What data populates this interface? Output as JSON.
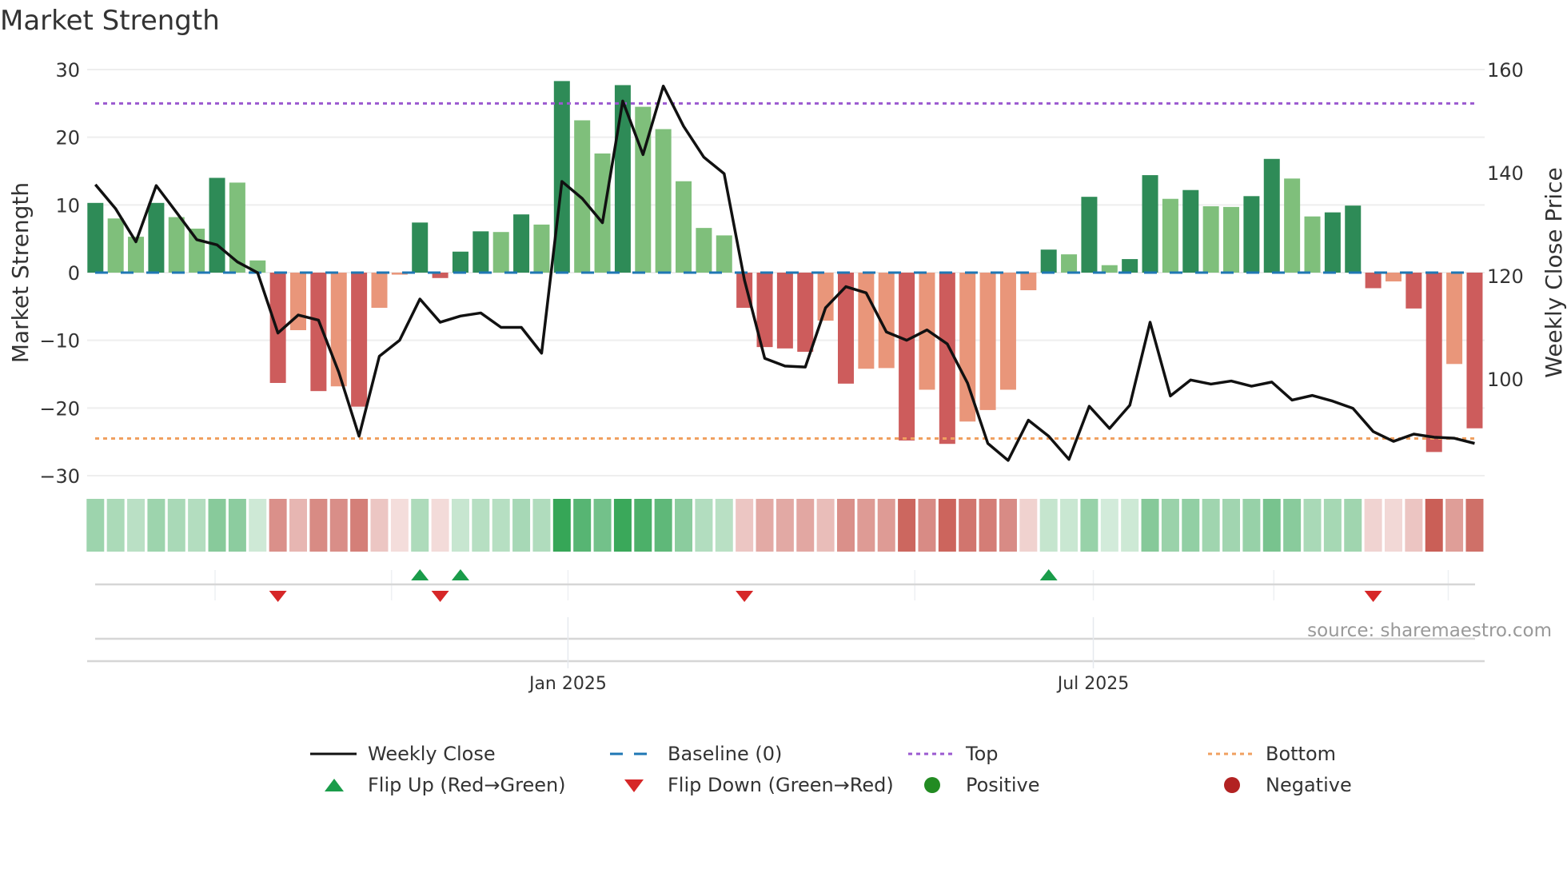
{
  "title": "Market Strength",
  "source": "source: sharemaestro.com",
  "chart_data": {
    "type": "bar",
    "title": "Market Strength",
    "ylabel": "Market Strength",
    "y2label": "Weekly Close Price",
    "ylim": [
      -30,
      30
    ],
    "y2lim": [
      80,
      160
    ],
    "left_ticks": [
      "30",
      "20",
      "10",
      "0",
      "−10",
      "−20",
      "−30"
    ],
    "left_tick_values": [
      30,
      20,
      10,
      0,
      -10,
      -20,
      -30
    ],
    "right_ticks": [
      "160",
      "140",
      "120",
      "100"
    ],
    "right_tick_values": [
      160,
      140,
      120,
      100
    ],
    "x_ticks": [
      {
        "label": "Jan 2025",
        "week_index": 23.3
      },
      {
        "label": "Jul 2025",
        "week_index": 49.2
      }
    ],
    "top_level": 25,
    "bottom_level": -24.5,
    "baseline": 0,
    "strength": [
      10.3,
      8,
      5.3,
      10.3,
      8.2,
      6.5,
      14,
      13.3,
      1.8,
      -16.3,
      -8.5,
      -17.5,
      -16.8,
      -19.8,
      -5.2,
      -0.3,
      7.4,
      -0.8,
      3.1,
      6.1,
      6.0,
      8.6,
      7.1,
      28.3,
      22.5,
      17.6,
      27.7,
      24.5,
      21.2,
      13.5,
      6.6,
      5.5,
      -5.2,
      -11,
      -11.2,
      -11.7,
      -7.1,
      -16.4,
      -14.2,
      -14.1,
      -24.8,
      -17.3,
      -25.3,
      -22,
      -20.3,
      -17.3,
      -2.6,
      3.4,
      2.7,
      11.2,
      1.1,
      2,
      14.4,
      10.9,
      12.2,
      9.8,
      9.7,
      11.3,
      16.8,
      13.9,
      8.3,
      8.9,
      9.9,
      -2.3,
      -1.3,
      -5.3,
      -26.5,
      -13.5,
      -23
    ],
    "weekly_close": [
      137.7,
      133,
      126.6,
      137.5,
      132.3,
      127,
      126,
      122.7,
      120.6,
      108.9,
      112.4,
      111.4,
      101.3,
      88.9,
      104.4,
      107.5,
      115.5,
      111,
      112.2,
      112.8,
      110,
      110,
      105,
      138.3,
      135,
      130.3,
      153.9,
      143.5,
      156.8,
      149,
      143,
      139.8,
      119.2,
      104,
      102.5,
      102.3,
      113.8,
      117.9,
      116.7,
      109.1,
      107.5,
      109.5,
      106.8,
      99.2,
      87.5,
      84.2,
      92,
      88.9,
      84.4,
      94.7,
      90.4,
      94.9,
      111,
      96.7,
      99.8,
      99,
      99.6,
      98.6,
      99.4,
      95.9,
      96.8,
      95.7,
      94.3,
      89.8,
      87.9,
      89.3,
      88.7,
      88.5,
      87.5
    ],
    "flip_up_weeks": [
      16,
      18,
      47
    ],
    "flip_down_weeks": [
      9,
      17,
      32,
      63
    ],
    "month_grid_weeks": [
      5.9,
      14.6,
      23.3,
      40.4,
      49.2,
      58.1,
      66.7
    ],
    "colors": {
      "pos_rising": "#2e8b57",
      "pos_falling": "#7fbf7b",
      "neg_falling": "#cd5c5c",
      "neg_rising": "#e9967a",
      "line": "#111111",
      "baseline": "#1f77b4",
      "top": "#9b59d0",
      "bottom": "#f0a060",
      "flip_up": "#1a9c4a",
      "flip_down": "#d62728",
      "positive": "#228b22",
      "negative": "#b22222"
    },
    "legend": [
      {
        "label": "Weekly Close",
        "symbol": "line"
      },
      {
        "label": "Baseline (0)",
        "symbol": "dash"
      },
      {
        "label": "Top",
        "symbol": "dot-top"
      },
      {
        "label": "Bottom",
        "symbol": "dot-bottom"
      },
      {
        "label": "Flip Up (Red→Green)",
        "symbol": "tri-up"
      },
      {
        "label": "Flip Down (Green→Red)",
        "symbol": "tri-down"
      },
      {
        "label": "Positive",
        "symbol": "circle-pos"
      },
      {
        "label": "Negative",
        "symbol": "circle-neg"
      }
    ]
  }
}
